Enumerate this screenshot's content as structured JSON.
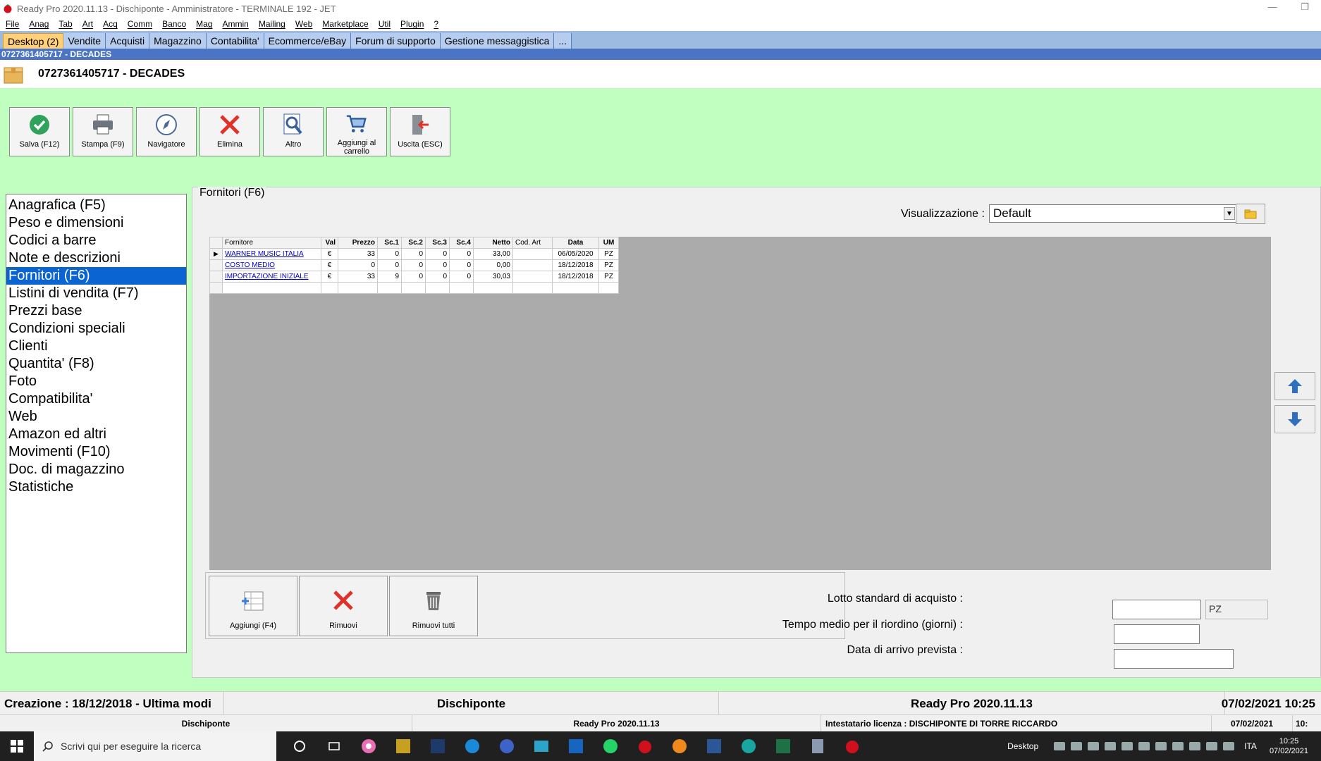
{
  "window": {
    "title": "Ready Pro 2020.11.13 - Dischiponte - Amministratore - TERMINALE 192 - JET"
  },
  "menu": [
    "File",
    "Anag",
    "Tab",
    "Art",
    "Acq",
    "Comm",
    "Banco",
    "Mag",
    "Ammin",
    "Mailing",
    "Web",
    "Marketplace",
    "Util",
    "Plugin",
    "?"
  ],
  "tabs": [
    "Desktop (2)",
    "Vendite",
    "Acquisti",
    "Magazzino",
    "Contabilita'",
    "Ecommerce/eBay",
    "Forum di supporto",
    "Gestione messaggistica",
    "..."
  ],
  "record": {
    "bar_title": "0727361405717 - DECADES",
    "header_title": "0727361405717 - DECADES"
  },
  "toolbar": {
    "save": "Salva (F12)",
    "print": "Stampa (F9)",
    "navigator": "Navigatore",
    "delete": "Elimina",
    "other": "Altro",
    "cart": "Aggiungi al carrello",
    "exit": "Uscita (ESC)"
  },
  "left_menu": [
    "Anagrafica (F5)",
    "Peso e dimensioni",
    "Codici a barre",
    "Note e descrizioni",
    "Fornitori (F6)",
    "Listini di vendita (F7)",
    "Prezzi base",
    "Condizioni speciali",
    "Clienti",
    "Quantita' (F8)",
    "Foto",
    "Compatibilita'",
    "Web",
    "Amazon ed altri",
    "Movimenti (F10)",
    "Doc. di magazzino",
    "Statistiche"
  ],
  "panel": {
    "legend": "Fornitori (F6)",
    "visualizzazione_label": "Visualizzazione :",
    "visualizzazione_value": "Default"
  },
  "grid": {
    "headers": [
      "Fornitore",
      "Val",
      "Prezzo",
      "Sc.1",
      "Sc.2",
      "Sc.3",
      "Sc.4",
      "Netto",
      "Cod. Art",
      "Data",
      "UM"
    ],
    "rows": [
      [
        "WARNER MUSIC ITALIA",
        "€",
        "33",
        "0",
        "0",
        "0",
        "0",
        "33,00",
        "",
        "06/05/2020",
        "PZ"
      ],
      [
        "COSTO MEDIO",
        "€",
        "0",
        "0",
        "0",
        "0",
        "0",
        "0,00",
        "",
        "18/12/2018",
        "PZ"
      ],
      [
        "IMPORTAZIONE INIZIALE",
        "€",
        "33",
        "9",
        "0",
        "0",
        "0",
        "30,03",
        "",
        "18/12/2018",
        "PZ"
      ]
    ]
  },
  "actions": {
    "add": "Aggiungi (F4)",
    "remove": "Rimuovi",
    "remove_all": "Rimuovi tutti"
  },
  "form": {
    "lotto_label": "Lotto standard di acquisto :",
    "lotto_value": "",
    "lotto_um": "PZ",
    "tempo_label": "Tempo medio per il riordino (giorni) :",
    "tempo_value": "",
    "data_label": "Data di arrivo prevista :",
    "data_value": ""
  },
  "status": {
    "creation": "Creazione : 18/12/2018 - Ultima modi",
    "company": "Dischiponte",
    "app": "Ready Pro 2020.11.13",
    "date_time": "07/02/2021  10:25",
    "company_small": "Dischiponte",
    "app_small": "Ready Pro 2020.11.13",
    "license": "Intestatario licenza : DISCHIPONTE DI TORRE RICCARDO",
    "date_small": "07/02/2021",
    "time_small": "10:"
  },
  "taskbar": {
    "search_placeholder": "Scrivi qui per eseguire la ricerca",
    "desktop_label": "Desktop",
    "lang": "ITA",
    "time": "10:25",
    "date": "07/02/2021"
  }
}
